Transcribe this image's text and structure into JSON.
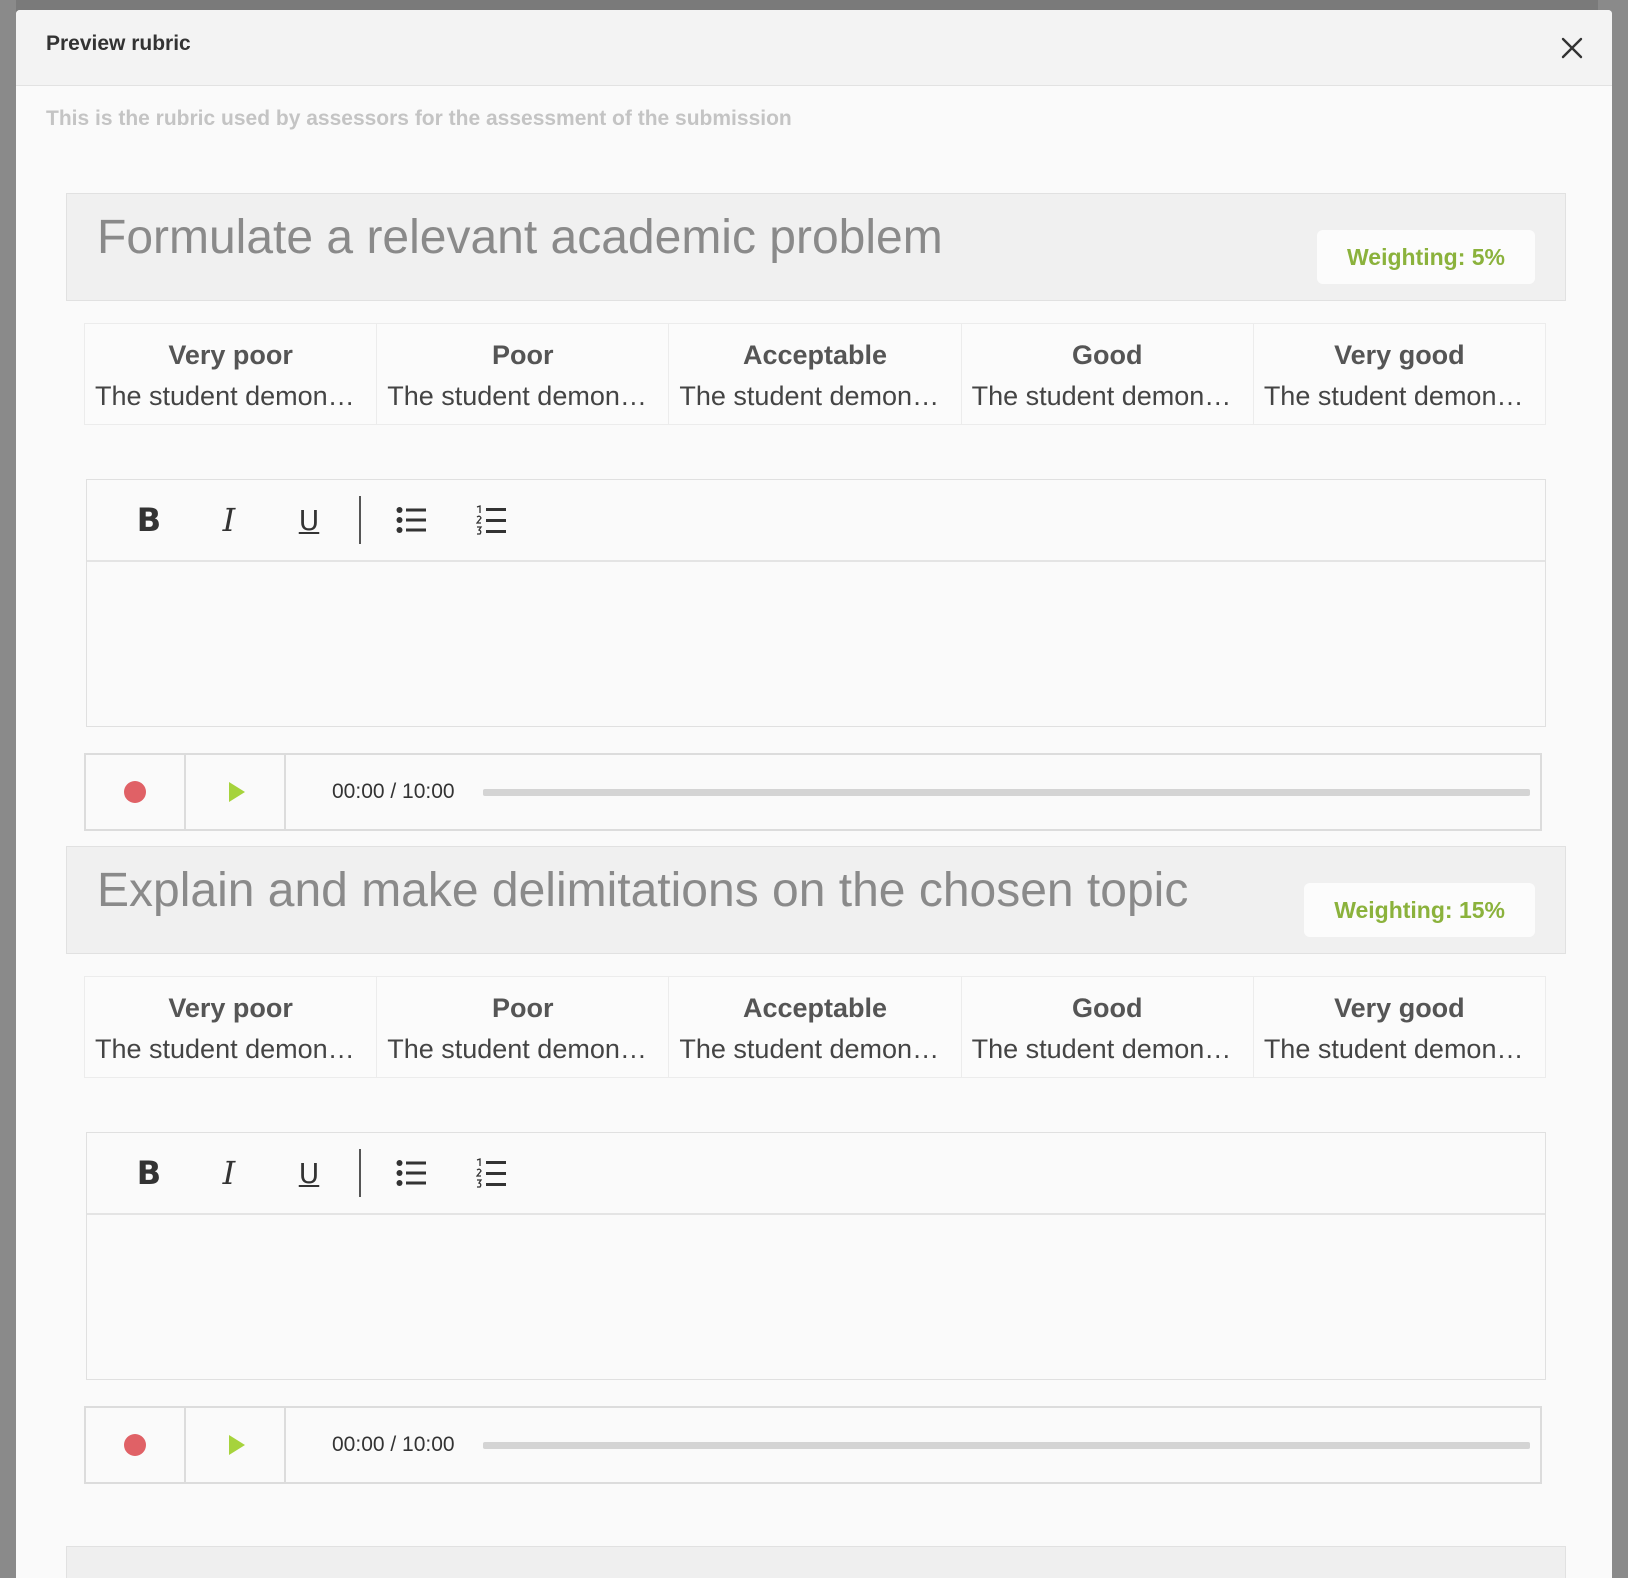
{
  "modal": {
    "title": "Preview rubric",
    "subtitle": "This is the rubric used by assessors for the assessment of the submission"
  },
  "criteria": [
    {
      "title": "Formulate a relevant academic problem",
      "weighting": "Weighting: 5%",
      "levels": [
        {
          "name": "Very poor",
          "desc": "The student demonstrates"
        },
        {
          "name": "Poor",
          "desc": "The student demonstrates"
        },
        {
          "name": "Acceptable",
          "desc": "The student demonstrates"
        },
        {
          "name": "Good",
          "desc": "The student demonstrates"
        },
        {
          "name": "Very good",
          "desc": "The student demonstrates"
        }
      ],
      "recorder": {
        "time": "00:00 / 10:00",
        "progress": 0
      }
    },
    {
      "title": "Explain and make delimitations on the chosen topic",
      "weighting": "Weighting: 15%",
      "levels": [
        {
          "name": "Very poor",
          "desc": "The student demonstrates"
        },
        {
          "name": "Poor",
          "desc": "The student demonstrates"
        },
        {
          "name": "Acceptable",
          "desc": "The student demonstrates"
        },
        {
          "name": "Good",
          "desc": "The student demonstrates"
        },
        {
          "name": "Very good",
          "desc": "The student demonstrates"
        }
      ],
      "recorder": {
        "time": "00:00 / 10:00",
        "progress": 0
      }
    }
  ],
  "toolbar": {
    "bold": "B",
    "italic": "I",
    "underline": "U"
  },
  "colors": {
    "accent_green": "#8bb23c",
    "record_red": "#e06166",
    "play_green": "#a6d33c"
  },
  "icons": [
    "close-icon",
    "bold-icon",
    "italic-icon",
    "underline-icon",
    "bullet-list-icon",
    "numbered-list-icon",
    "record-icon",
    "play-icon"
  ]
}
